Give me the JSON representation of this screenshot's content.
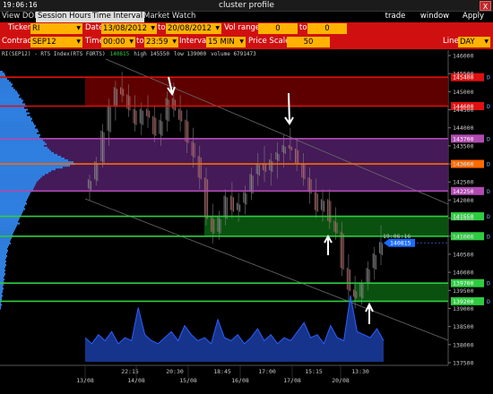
{
  "window": {
    "clock": "19:06:16",
    "title": "cluster profile",
    "close_glyph": "X"
  },
  "menu": {
    "tabs": [
      "View DOM",
      "Session Hours",
      "Time Interval",
      "Market Watch"
    ],
    "selected_tabs": [
      1,
      2
    ],
    "right": [
      "trade",
      "window",
      "Apply"
    ]
  },
  "toolbar": {
    "ticker_label": "Ticker",
    "ticker_value": "RI",
    "date_label": "Date",
    "date_from": "13/08/2012",
    "date_to_label": "to",
    "date_to": "20/08/2012",
    "vol_range_label": "Vol range",
    "vol_from": "0",
    "vol_to_label": "to",
    "vol_to": "0",
    "contract_label": "Contract",
    "contract_value": "SEP12",
    "time_label": "Time",
    "time_from": "00:00",
    "time_to_label": "to",
    "time_to": "23:59",
    "interval_label": "Interval",
    "interval_value": "15 MIN",
    "price_scale_label": "Price Scale",
    "price_scale_value": "50",
    "line_label": "Line",
    "line_value": "DAY"
  },
  "chart_info": {
    "symbol": "RI(SEP12) - RTS Index(RTS FORTS)",
    "last": "140815",
    "high": "high 145550",
    "low": "low 139000",
    "volume": "volume 6791473"
  },
  "colors": {
    "toolbar": "#d01010",
    "field": "#ffb300",
    "resistance_zone": "#6e0000",
    "purple_zone": "#4b1d62",
    "support_zone": "#0b5a12",
    "volume": "#2a5fff",
    "profile": "#2f7fe0",
    "last_price": "#1a6bff"
  },
  "chart_data": {
    "type": "candlestick",
    "y_axis_ticks": [
      146000,
      145500,
      145000,
      144500,
      144000,
      143500,
      143000,
      142500,
      142000,
      141500,
      141000,
      140500,
      140000,
      139500,
      139000,
      138500,
      138000,
      137500
    ],
    "ylim": [
      137500,
      146000
    ],
    "x_tick_labels_top": [
      "22:15",
      "20:30",
      "18:45",
      "17:00",
      "15:15",
      "13:30"
    ],
    "x_tick_labels_bottom": [
      "13/08",
      "14/08",
      "15/08",
      "16/08",
      "17/08",
      "20/08"
    ],
    "levels": [
      {
        "price": "145400",
        "color": "#e01010",
        "tag": "D"
      },
      {
        "price": "144600",
        "color": "#e01010",
        "tag": "D"
      },
      {
        "price": "143700",
        "color": "#b04ab0",
        "tag": "D"
      },
      {
        "price": "143000",
        "color": "#ff6a00",
        "tag": "D"
      },
      {
        "price": "142250",
        "color": "#b04ab0",
        "tag": "D"
      },
      {
        "price": "141550",
        "color": "#2ecc40",
        "tag": "D"
      },
      {
        "price": "141000",
        "color": "#2ecc40",
        "tag": "D"
      },
      {
        "price": "139700",
        "color": "#2ecc40",
        "tag": "D"
      },
      {
        "price": "139200",
        "color": "#2ecc40",
        "tag": "D"
      }
    ],
    "last_price": {
      "time": "19:06:16",
      "price": "140815"
    },
    "candles": [
      [
        142300,
        142700,
        142000,
        142550
      ],
      [
        142550,
        143200,
        142400,
        143050
      ],
      [
        143050,
        144100,
        142900,
        143900
      ],
      [
        143900,
        144800,
        143500,
        144600
      ],
      [
        144600,
        145300,
        144200,
        145100
      ],
      [
        145100,
        145550,
        144700,
        144900
      ],
      [
        144900,
        145200,
        144300,
        144500
      ],
      [
        144500,
        144900,
        143900,
        144100
      ],
      [
        144100,
        144700,
        143800,
        144500
      ],
      [
        144500,
        144900,
        144000,
        144300
      ],
      [
        144300,
        144600,
        143600,
        143800
      ],
      [
        143800,
        144400,
        143500,
        144200
      ],
      [
        144200,
        145000,
        143900,
        144800
      ],
      [
        144800,
        145250,
        144300,
        144500
      ],
      [
        144500,
        144900,
        143900,
        144200
      ],
      [
        144200,
        144500,
        143300,
        143600
      ],
      [
        143600,
        144000,
        142900,
        143200
      ],
      [
        143200,
        143500,
        142300,
        142600
      ],
      [
        142600,
        142900,
        141300,
        141500
      ],
      [
        141500,
        141900,
        140800,
        141100
      ],
      [
        141100,
        141700,
        140900,
        141500
      ],
      [
        141500,
        142300,
        141300,
        142100
      ],
      [
        142100,
        142500,
        141500,
        141700
      ],
      [
        141700,
        142200,
        141400,
        141900
      ],
      [
        141900,
        142400,
        141600,
        142200
      ],
      [
        142200,
        142900,
        142000,
        142700
      ],
      [
        142700,
        143300,
        142400,
        143000
      ],
      [
        143000,
        143500,
        142500,
        142800
      ],
      [
        142800,
        143300,
        142400,
        143100
      ],
      [
        143100,
        143600,
        142600,
        143300
      ],
      [
        143300,
        143800,
        142900,
        143500
      ],
      [
        143500,
        144000,
        143100,
        143400
      ],
      [
        143400,
        143700,
        142800,
        143000
      ],
      [
        143000,
        143300,
        142400,
        142600
      ],
      [
        142600,
        142900,
        141900,
        142200
      ],
      [
        142200,
        142600,
        141500,
        141700
      ],
      [
        141700,
        142300,
        141400,
        142000
      ],
      [
        142000,
        142300,
        141200,
        141400
      ],
      [
        141400,
        141800,
        140900,
        141100
      ],
      [
        141100,
        141400,
        139900,
        140100
      ],
      [
        140100,
        140500,
        139200,
        139500
      ],
      [
        139500,
        139900,
        139000,
        139300
      ],
      [
        139300,
        139800,
        139100,
        139700
      ],
      [
        139700,
        140300,
        139500,
        140100
      ],
      [
        140100,
        140700,
        139800,
        140500
      ],
      [
        140500,
        141300,
        140200,
        140815
      ]
    ],
    "volume": [
      8,
      6,
      9,
      7,
      10,
      6,
      8,
      7,
      18,
      9,
      7,
      6,
      8,
      10,
      7,
      12,
      9,
      7,
      8,
      6,
      14,
      8,
      7,
      9,
      6,
      8,
      11,
      7,
      9,
      6,
      8,
      7,
      10,
      13,
      8,
      9,
      6,
      12,
      8,
      7,
      22,
      10,
      9,
      8,
      11,
      7
    ],
    "volume_axis_max": 22,
    "profile": [
      {
        "price": 145550,
        "v": 3
      },
      {
        "price": 145500,
        "v": 5
      },
      {
        "price": 145450,
        "v": 6
      },
      {
        "price": 145400,
        "v": 7
      },
      {
        "price": 145350,
        "v": 8
      },
      {
        "price": 145300,
        "v": 10
      },
      {
        "price": 145250,
        "v": 12
      },
      {
        "price": 145200,
        "v": 14
      },
      {
        "price": 145150,
        "v": 13
      },
      {
        "price": 145100,
        "v": 15
      },
      {
        "price": 145050,
        "v": 17
      },
      {
        "price": 145000,
        "v": 19
      },
      {
        "price": 144950,
        "v": 20
      },
      {
        "price": 144900,
        "v": 22
      },
      {
        "price": 144850,
        "v": 21
      },
      {
        "price": 144800,
        "v": 24
      },
      {
        "price": 144750,
        "v": 26
      },
      {
        "price": 144700,
        "v": 25
      },
      {
        "price": 144650,
        "v": 28
      },
      {
        "price": 144600,
        "v": 30
      },
      {
        "price": 144550,
        "v": 27
      },
      {
        "price": 144500,
        "v": 31
      },
      {
        "price": 144450,
        "v": 29
      },
      {
        "price": 144400,
        "v": 33
      },
      {
        "price": 144350,
        "v": 30
      },
      {
        "price": 144300,
        "v": 34
      },
      {
        "price": 144250,
        "v": 36
      },
      {
        "price": 144200,
        "v": 35
      },
      {
        "price": 144150,
        "v": 37
      },
      {
        "price": 144100,
        "v": 38
      },
      {
        "price": 144050,
        "v": 40
      },
      {
        "price": 144000,
        "v": 39
      },
      {
        "price": 143950,
        "v": 42
      },
      {
        "price": 143900,
        "v": 43
      },
      {
        "price": 143850,
        "v": 41
      },
      {
        "price": 143800,
        "v": 45
      },
      {
        "price": 143750,
        "v": 44
      },
      {
        "price": 143700,
        "v": 46
      },
      {
        "price": 143650,
        "v": 48
      },
      {
        "price": 143600,
        "v": 50
      },
      {
        "price": 143550,
        "v": 52
      },
      {
        "price": 143500,
        "v": 49
      },
      {
        "price": 143450,
        "v": 53
      },
      {
        "price": 143400,
        "v": 55
      },
      {
        "price": 143350,
        "v": 57
      },
      {
        "price": 143300,
        "v": 60
      },
      {
        "price": 143250,
        "v": 64
      },
      {
        "price": 143200,
        "v": 68
      },
      {
        "price": 143150,
        "v": 72
      },
      {
        "price": 143100,
        "v": 76
      },
      {
        "price": 143050,
        "v": 82
      },
      {
        "price": 143000,
        "v": 84
      },
      {
        "price": 142950,
        "v": 78
      },
      {
        "price": 142900,
        "v": 70
      },
      {
        "price": 142850,
        "v": 62
      },
      {
        "price": 142800,
        "v": 57
      },
      {
        "price": 142750,
        "v": 54
      },
      {
        "price": 142700,
        "v": 50
      },
      {
        "price": 142650,
        "v": 47
      },
      {
        "price": 142600,
        "v": 45
      },
      {
        "price": 142550,
        "v": 43
      },
      {
        "price": 142500,
        "v": 41
      },
      {
        "price": 142450,
        "v": 40
      },
      {
        "price": 142400,
        "v": 39
      },
      {
        "price": 142350,
        "v": 38
      },
      {
        "price": 142300,
        "v": 37
      },
      {
        "price": 142250,
        "v": 36
      },
      {
        "price": 142200,
        "v": 34
      },
      {
        "price": 142150,
        "v": 33
      },
      {
        "price": 142100,
        "v": 32
      },
      {
        "price": 142050,
        "v": 31
      },
      {
        "price": 142000,
        "v": 30
      },
      {
        "price": 141950,
        "v": 29
      },
      {
        "price": 141900,
        "v": 30
      },
      {
        "price": 141850,
        "v": 28
      },
      {
        "price": 141800,
        "v": 27
      },
      {
        "price": 141750,
        "v": 28
      },
      {
        "price": 141700,
        "v": 26
      },
      {
        "price": 141650,
        "v": 25
      },
      {
        "price": 141600,
        "v": 24
      },
      {
        "price": 141550,
        "v": 23
      },
      {
        "price": 141500,
        "v": 22
      },
      {
        "price": 141450,
        "v": 21
      },
      {
        "price": 141400,
        "v": 20
      },
      {
        "price": 141350,
        "v": 22
      },
      {
        "price": 141300,
        "v": 19
      },
      {
        "price": 141250,
        "v": 18
      },
      {
        "price": 141200,
        "v": 17
      },
      {
        "price": 141150,
        "v": 16
      },
      {
        "price": 141100,
        "v": 15
      },
      {
        "price": 141050,
        "v": 14
      },
      {
        "price": 141000,
        "v": 15
      },
      {
        "price": 140950,
        "v": 13
      },
      {
        "price": 140900,
        "v": 12
      },
      {
        "price": 140850,
        "v": 11
      },
      {
        "price": 140800,
        "v": 12
      },
      {
        "price": 140750,
        "v": 10
      },
      {
        "price": 140700,
        "v": 9
      },
      {
        "price": 140650,
        "v": 8
      },
      {
        "price": 140600,
        "v": 9
      },
      {
        "price": 140550,
        "v": 8
      },
      {
        "price": 140500,
        "v": 7
      },
      {
        "price": 140450,
        "v": 8
      },
      {
        "price": 140400,
        "v": 7
      },
      {
        "price": 140350,
        "v": 6
      },
      {
        "price": 140300,
        "v": 7
      },
      {
        "price": 140250,
        "v": 6
      },
      {
        "price": 140200,
        "v": 7
      },
      {
        "price": 140150,
        "v": 6
      },
      {
        "price": 140100,
        "v": 5
      },
      {
        "price": 140050,
        "v": 6
      },
      {
        "price": 140000,
        "v": 5
      },
      {
        "price": 139950,
        "v": 6
      },
      {
        "price": 139900,
        "v": 5
      },
      {
        "price": 139850,
        "v": 4
      },
      {
        "price": 139800,
        "v": 5
      },
      {
        "price": 139750,
        "v": 4
      },
      {
        "price": 139700,
        "v": 5
      },
      {
        "price": 139650,
        "v": 4
      },
      {
        "price": 139600,
        "v": 3
      },
      {
        "price": 139550,
        "v": 4
      },
      {
        "price": 139500,
        "v": 3
      },
      {
        "price": 139450,
        "v": 3
      },
      {
        "price": 139400,
        "v": 2
      },
      {
        "price": 139350,
        "v": 3
      },
      {
        "price": 139300,
        "v": 2
      },
      {
        "price": 139250,
        "v": 2
      },
      {
        "price": 139200,
        "v": 2
      },
      {
        "price": 139150,
        "v": 1
      },
      {
        "price": 139100,
        "v": 2
      },
      {
        "price": 139050,
        "v": 1
      },
      {
        "price": 139000,
        "v": 1
      }
    ],
    "profile_axis_max": 84
  }
}
